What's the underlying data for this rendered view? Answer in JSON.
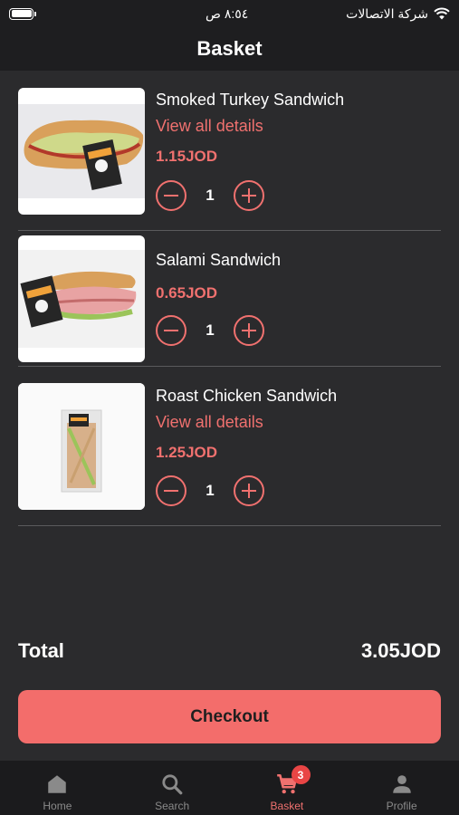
{
  "status_bar": {
    "time": "٨:٥٤ ص",
    "carrier": "شركة الاتصالات"
  },
  "header": {
    "title": "Basket"
  },
  "items": [
    {
      "name": "Smoked Turkey Sandwich",
      "link": "View all details",
      "price": "1.15JOD",
      "quantity": "1",
      "image_icon": "sandwich-image"
    },
    {
      "name": "Salami Sandwich",
      "price": "0.65JOD",
      "quantity": "1",
      "image_icon": "sandwich-image"
    },
    {
      "name": "Roast Chicken Sandwich",
      "link": "View all details",
      "price": "1.25JOD",
      "quantity": "1",
      "image_icon": "sandwich-image"
    }
  ],
  "summary": {
    "total_label": "Total",
    "total_value": "3.05JOD"
  },
  "checkout_label": "Checkout",
  "tabbar": {
    "tabs": [
      {
        "label": "Home",
        "icon": "home-icon"
      },
      {
        "label": "Search",
        "icon": "search-icon"
      },
      {
        "label": "Basket",
        "icon": "cart-icon",
        "badge": "3",
        "active": true
      },
      {
        "label": "Profile",
        "icon": "person-icon"
      }
    ]
  },
  "colors": {
    "accent": "#f0716f",
    "background": "#2b2b2d",
    "bar": "#1e1e20",
    "badge": "#e94545"
  }
}
